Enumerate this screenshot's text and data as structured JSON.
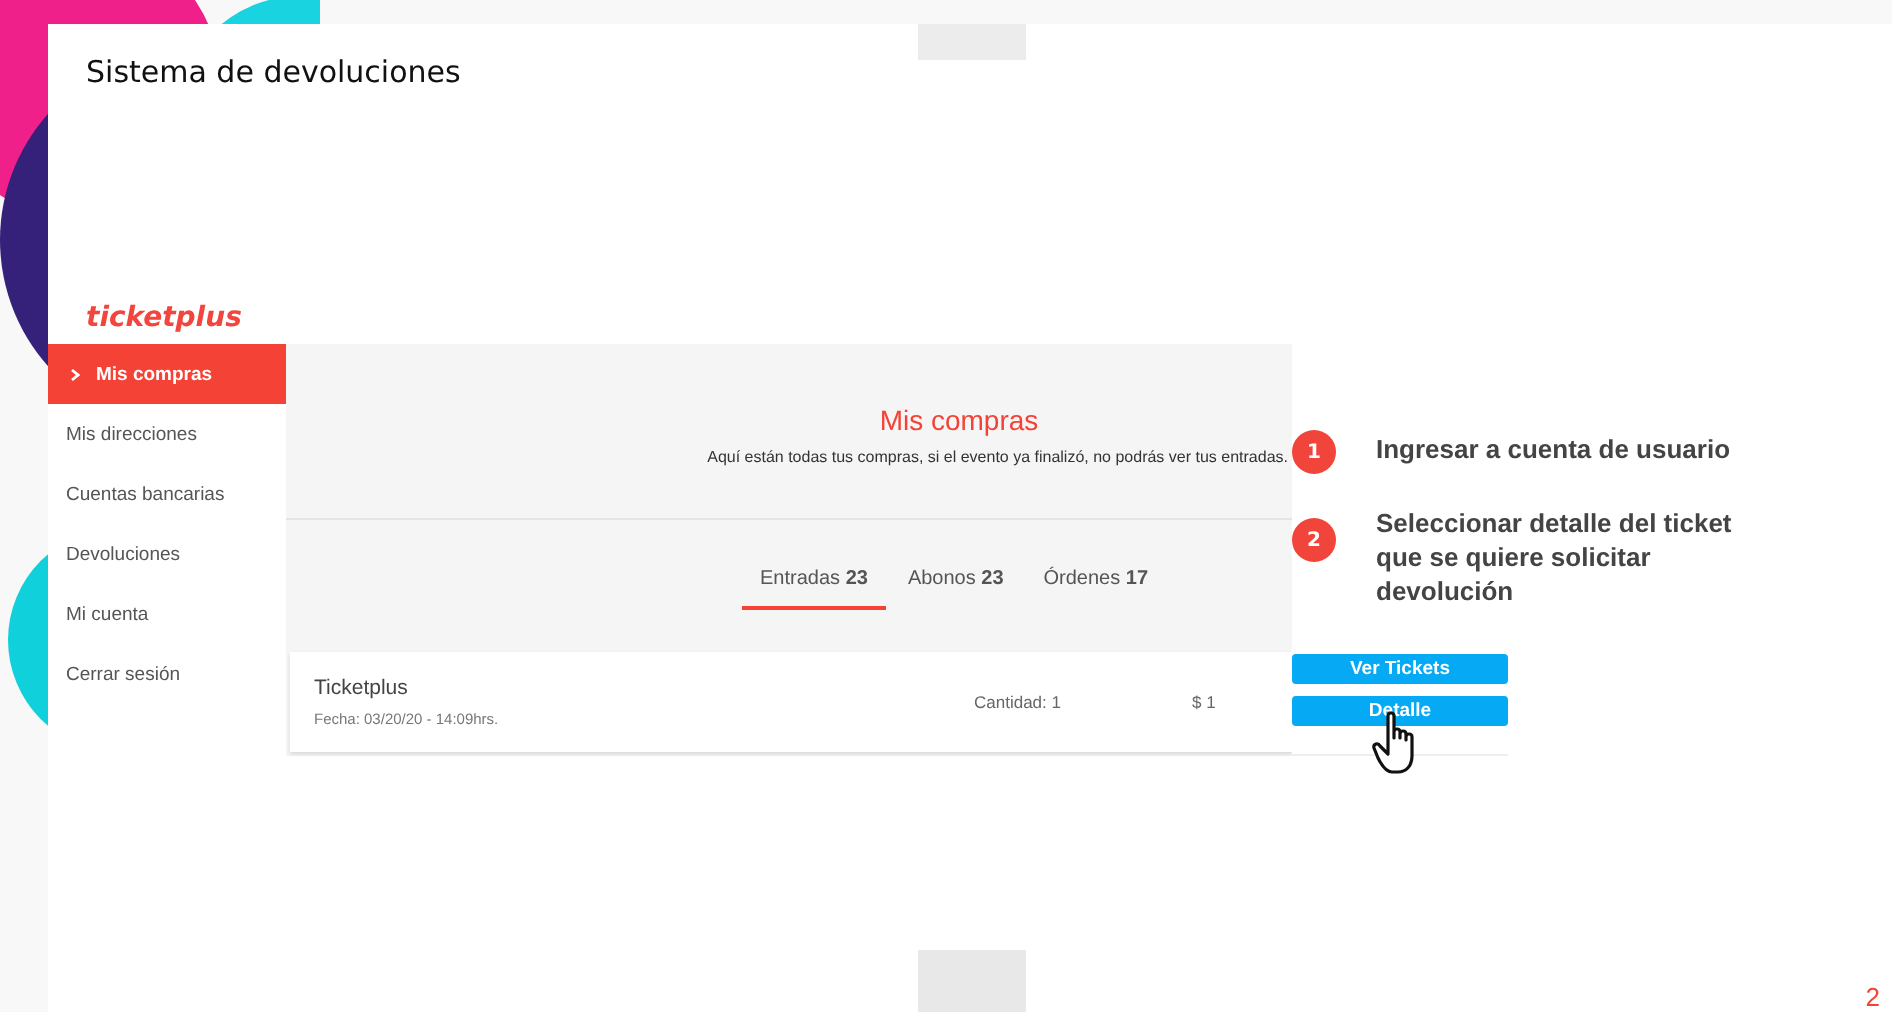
{
  "slide": {
    "title": "Sistema de devoluciones",
    "page_number": "2"
  },
  "app": {
    "logo": "ticketplus",
    "sidebar": [
      {
        "label": "Mis compras",
        "selected": true
      },
      {
        "label": "Mis direcciones",
        "selected": false
      },
      {
        "label": "Cuentas bancarias",
        "selected": false
      },
      {
        "label": "Devoluciones",
        "selected": false
      },
      {
        "label": "Mi cuenta",
        "selected": false
      },
      {
        "label": "Cerrar sesión",
        "selected": false
      }
    ],
    "header": {
      "title": "Mis compras",
      "subtitle": "Aquí están todas tus compras, si el evento ya finalizó, no podrás ver tus entradas."
    },
    "tabs": [
      {
        "label": "Entradas **23**",
        "selected": true
      },
      {
        "label": "Abonos **23**",
        "selected": false
      },
      {
        "label": "Órdenes **17**",
        "selected": false
      }
    ],
    "purchases": [
      {
        "name": "Ticketplus",
        "date": "Fecha: 03/20/20 - 14:09hrs.",
        "quantity": "Cantidad: 1",
        "price": "$ 1",
        "buttons": [
          "Ver Tickets",
          "Detalle"
        ]
      }
    ]
  },
  "steps": [
    {
      "number": "1",
      "text": "Ingresar a cuenta de usuario"
    },
    {
      "number": "2",
      "text": "Seleccionar detalle del ticket que se quiere solicitar devolución"
    }
  ]
}
